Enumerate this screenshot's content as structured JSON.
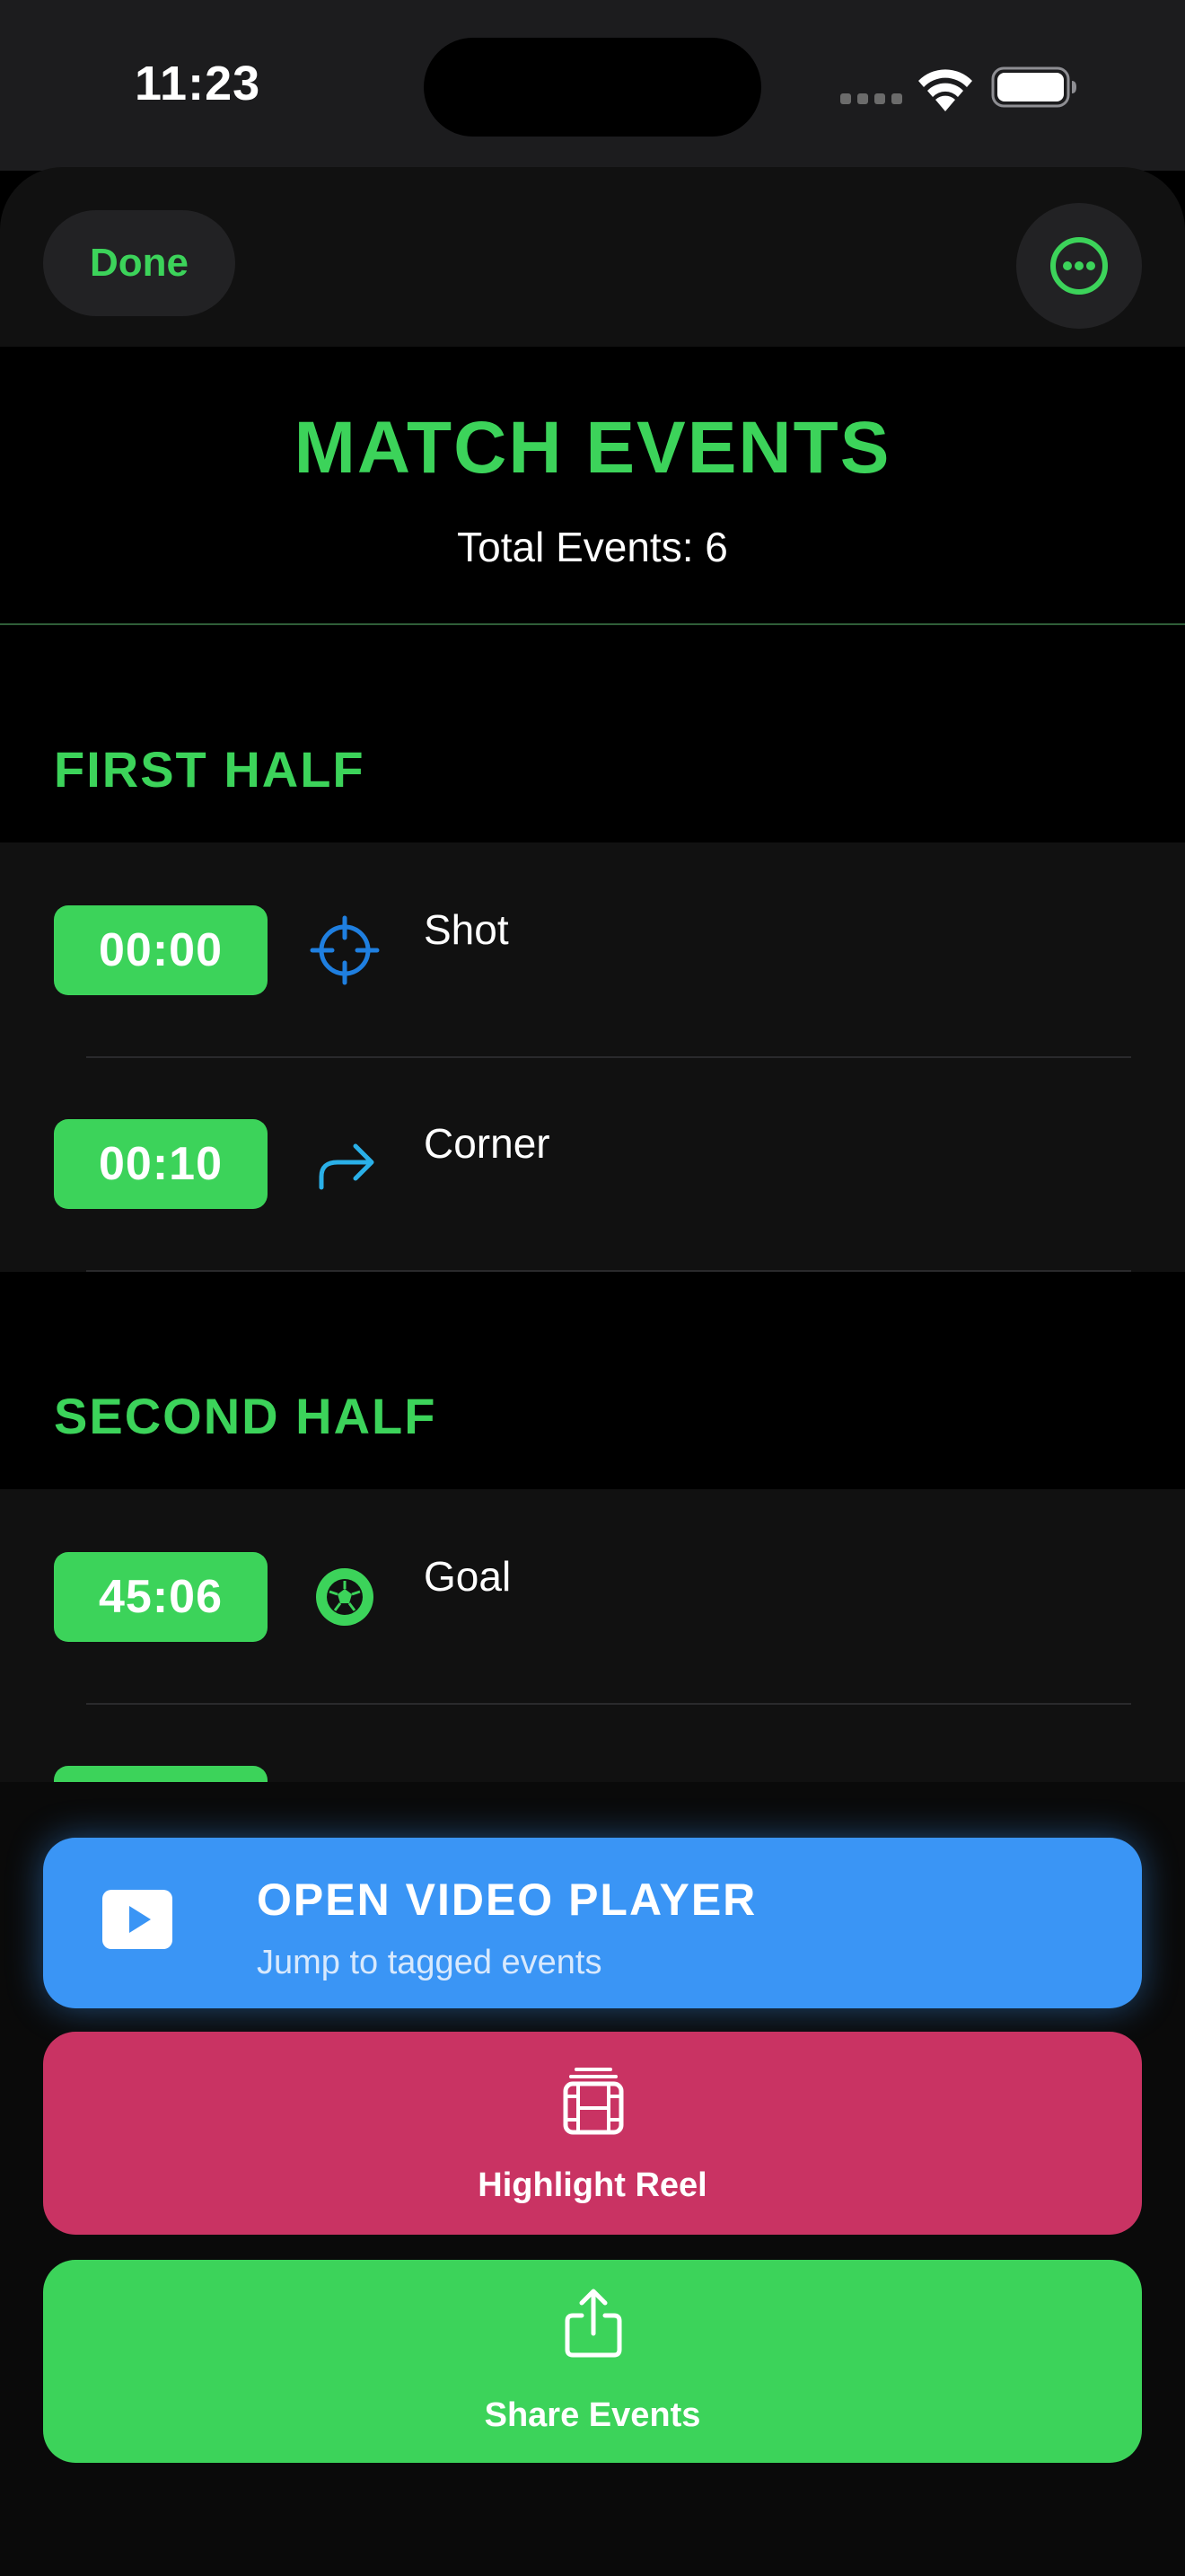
{
  "status_bar": {
    "time": "11:23",
    "icons": [
      "signal-icon",
      "wifi-icon",
      "battery-icon"
    ]
  },
  "header": {
    "done_label": "Done",
    "more_icon": "ellipsis-circle-icon"
  },
  "title": "MATCH EVENTS",
  "total_events": "Total Events: 6",
  "sections": [
    {
      "title": "FIRST HALF",
      "events": [
        {
          "time": "00:00",
          "name": "Shot",
          "icon": "crosshair-icon",
          "icon_color": "#1f7fe0"
        },
        {
          "time": "00:10",
          "name": "Corner",
          "icon": "arrow-turn-right-icon",
          "icon_color": "#2ab0e8"
        }
      ]
    },
    {
      "title": "SECOND HALF",
      "events": [
        {
          "time": "45:06",
          "name": "Goal",
          "icon": "soccer-ball-icon",
          "icon_color": "#3cd35a"
        }
      ]
    }
  ],
  "actions": {
    "video_title": "OPEN VIDEO PLAYER",
    "video_subtitle": "Jump to tagged events",
    "reel_label": "Highlight Reel",
    "share_label": "Share Events"
  },
  "colors": {
    "accent": "#3cd35a",
    "video_button": "#3a95f5",
    "reel_button": "#c93363",
    "share_button": "#3cd35a"
  }
}
